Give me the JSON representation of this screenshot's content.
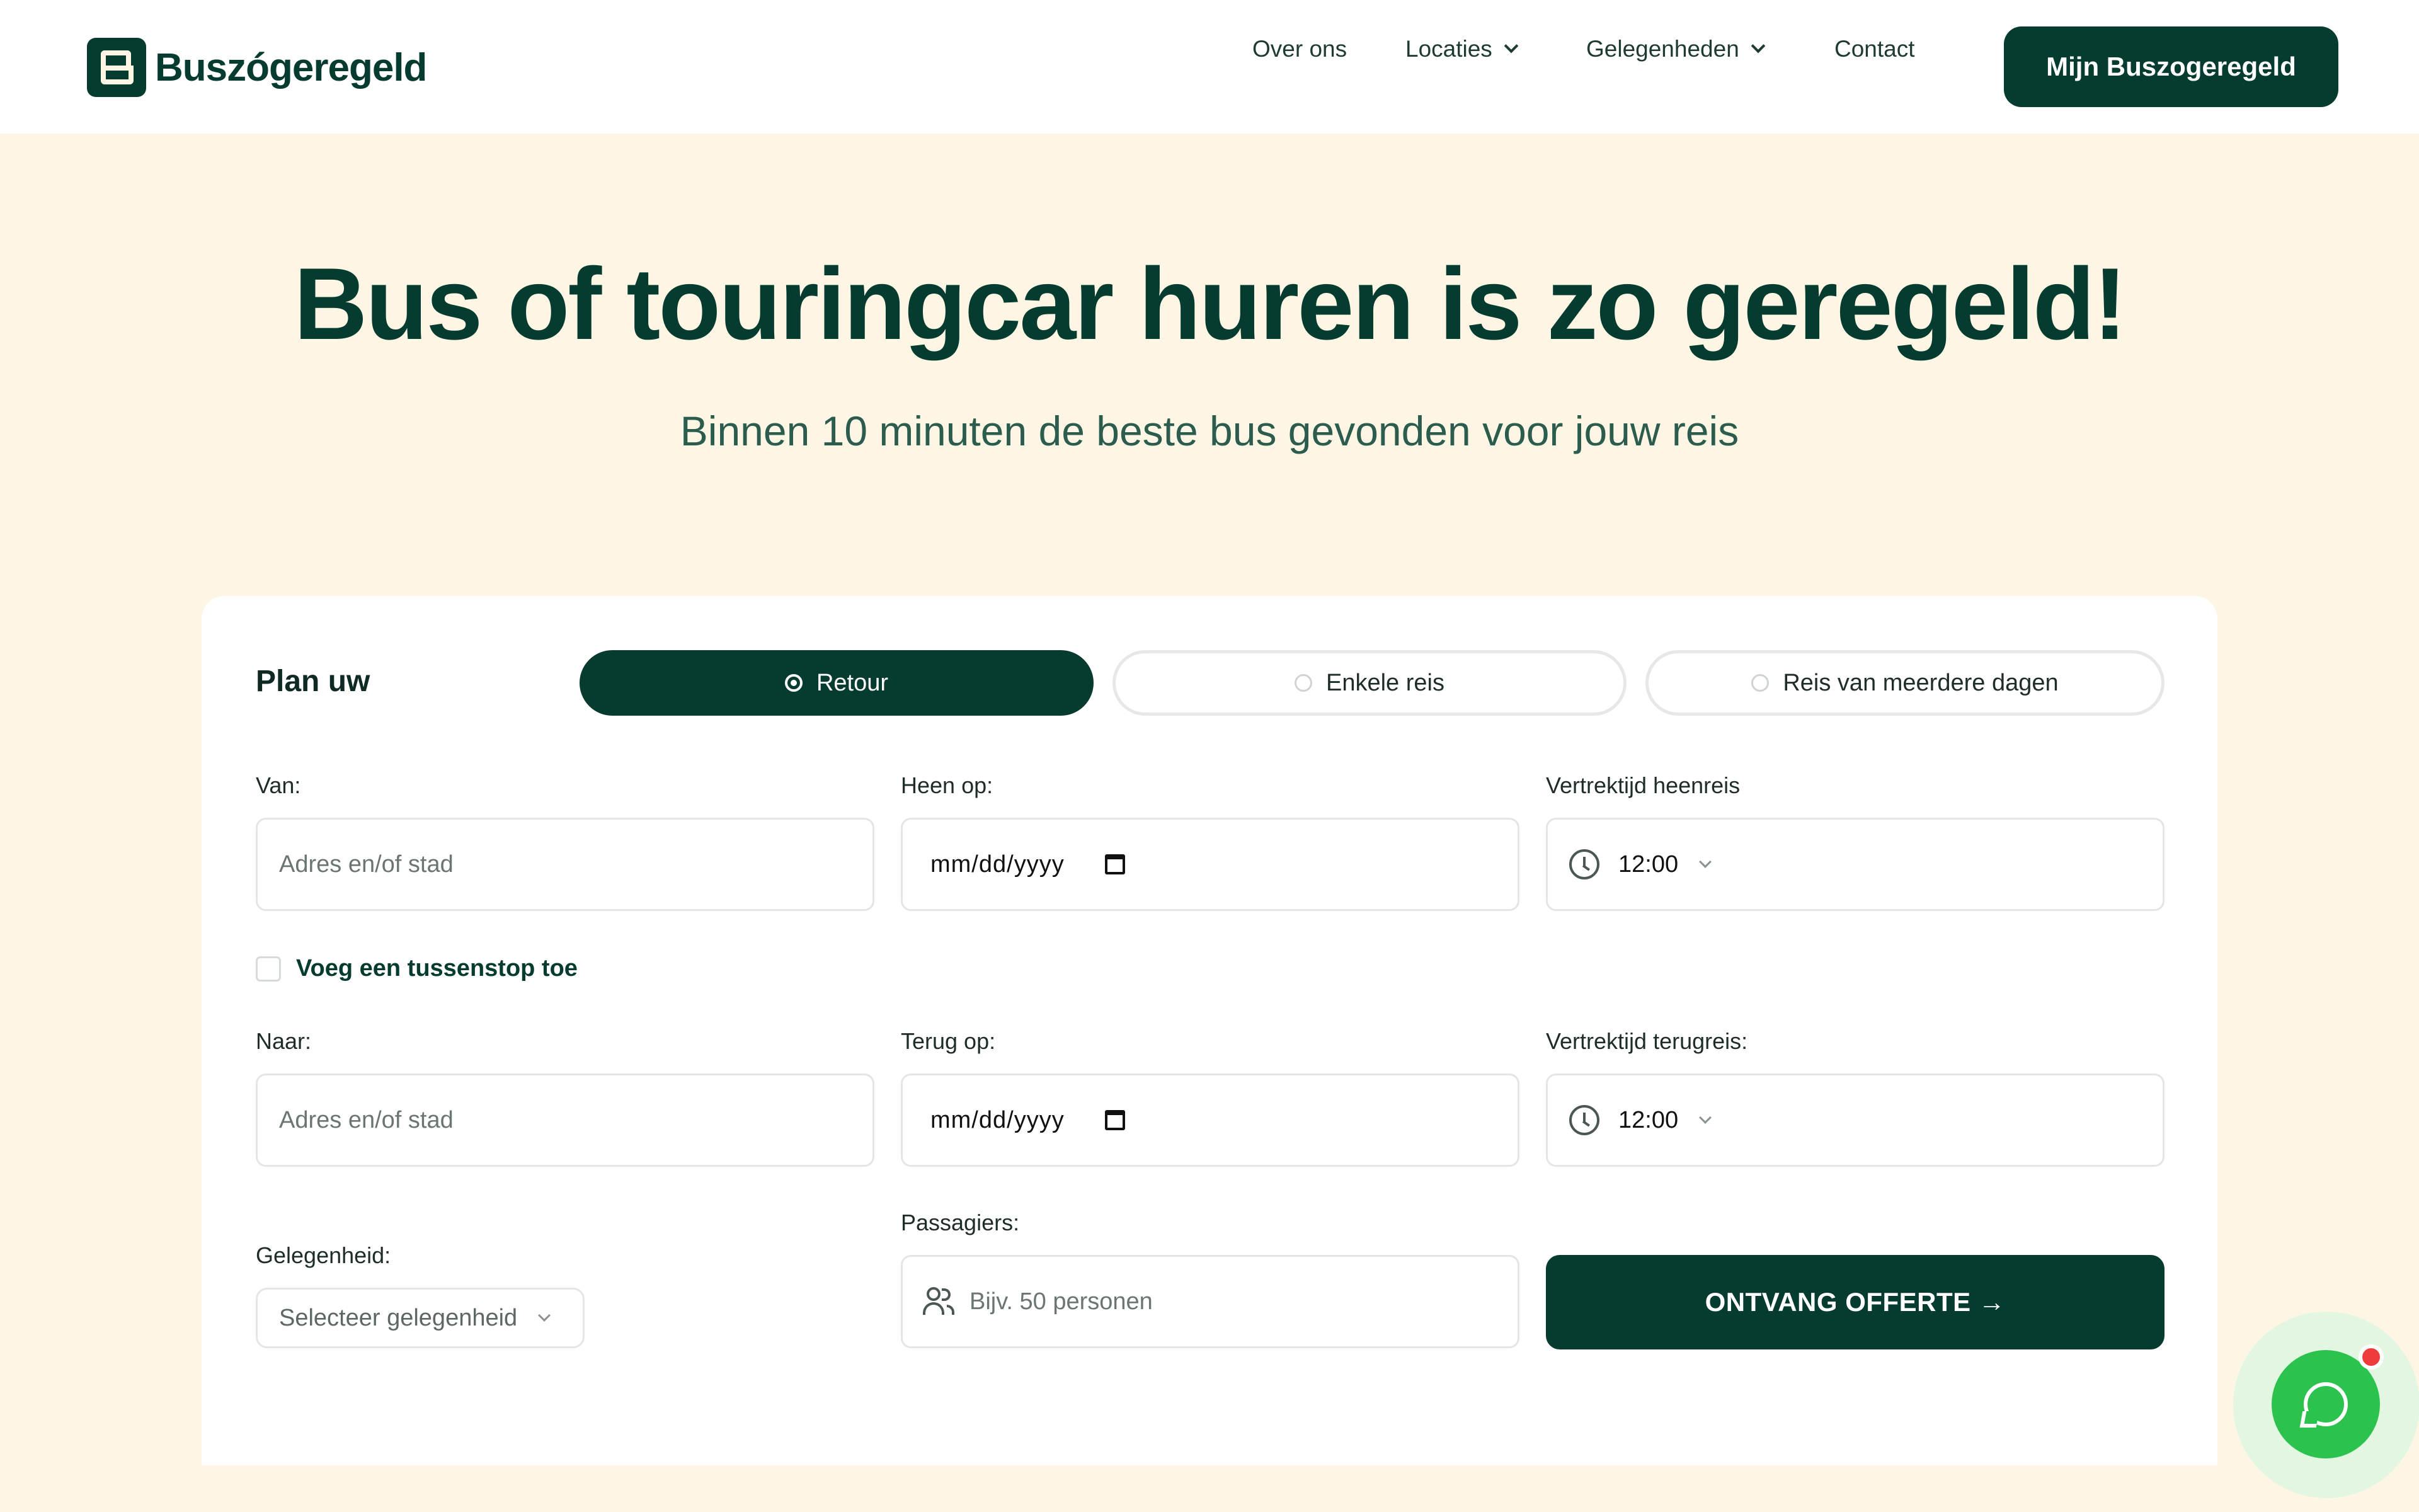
{
  "header": {
    "logo_text": "Buszógeregeld",
    "nav": [
      {
        "label": "Over ons",
        "has_dropdown": false
      },
      {
        "label": "Locaties",
        "has_dropdown": true
      },
      {
        "label": "Gelegenheden",
        "has_dropdown": true
      },
      {
        "label": "Contact",
        "has_dropdown": false
      }
    ],
    "account_button": "Mijn Buszogeregeld"
  },
  "hero": {
    "title": "Bus of touringcar huren is zo geregeld!",
    "subtitle": "Binnen 10 minuten de beste bus gevonden voor jouw reis"
  },
  "form": {
    "plan_label": "Plan uw",
    "trip_types": [
      {
        "label": "Retour",
        "selected": true
      },
      {
        "label": "Enkele reis",
        "selected": false
      },
      {
        "label": "Reis van meerdere dagen",
        "selected": false
      }
    ],
    "from": {
      "label": "Van:",
      "placeholder": "Adres en/of stad"
    },
    "depart_date": {
      "label": "Heen op:",
      "value": "mm/dd/yyyy"
    },
    "depart_time": {
      "label": "Vertrektijd heenreis",
      "value": "12:00"
    },
    "stopover": {
      "label": "Voeg een tussenstop toe",
      "checked": false
    },
    "to": {
      "label": "Naar:",
      "placeholder": "Adres en/of stad"
    },
    "return_date": {
      "label": "Terug op:",
      "value": "mm/dd/yyyy"
    },
    "return_time": {
      "label": "Vertrektijd terugreis:",
      "value": "12:00"
    },
    "occasion": {
      "label": "Gelegenheid:",
      "placeholder": "Selecteer gelegenheid"
    },
    "passengers": {
      "label": "Passagiers:",
      "placeholder": "Bijv. 50 personen"
    },
    "submit": "ONTVANG OFFERTE →"
  },
  "colors": {
    "brand_dark": "#063b30",
    "hero_bg": "#fef6e4",
    "chat_green": "#2bc24d",
    "notification_red": "#ef3b3b"
  },
  "icons": [
    "logo-icon",
    "chevron-down-icon",
    "clock-icon",
    "calendar-icon",
    "people-icon",
    "chat-icon"
  ]
}
